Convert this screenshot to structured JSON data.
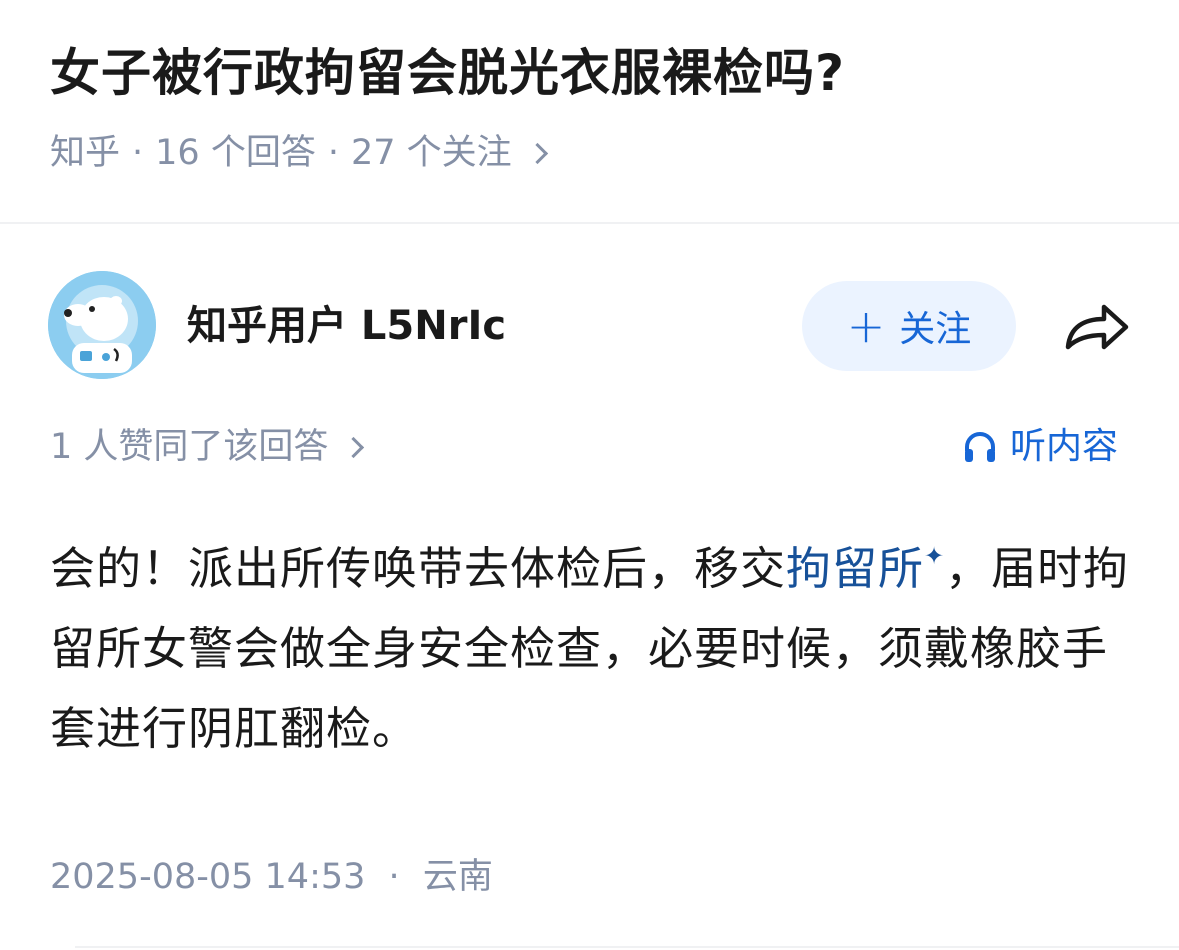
{
  "question": {
    "title": "女子被行政拘留会脱光衣服裸检吗?",
    "source": "知乎",
    "separator": "·",
    "answer_count_text": "16 个回答",
    "follower_count_text": "27 个关注"
  },
  "author": {
    "name": "知乎用户 L5NrIc",
    "avatar_icon": "polar-bear-astronaut-avatar"
  },
  "follow_button": {
    "label": "关注",
    "icon": "plus-icon",
    "background": "#ebf3ff",
    "color": "#1766d6"
  },
  "share_button": {
    "icon": "share-arrow-icon"
  },
  "likes": {
    "text": "1 人赞同了该回答"
  },
  "listen": {
    "label": "听内容",
    "icon": "headphones-icon"
  },
  "answer": {
    "text_before": "会的！派出所传唤带去体检后，移交",
    "keyword": "拘留所",
    "keyword_star": "✦",
    "text_after": "，届时拘留所女警会做全身安全检查，必要时候，须戴橡胶手套进行阴肛翻检。"
  },
  "answer_meta": {
    "datetime": "2025-08-05 14:53",
    "separator": "·",
    "location": "云南"
  },
  "colors": {
    "accent": "#1766d6",
    "link": "#175199",
    "muted": "#8590a6",
    "text": "#1a1a1a"
  }
}
